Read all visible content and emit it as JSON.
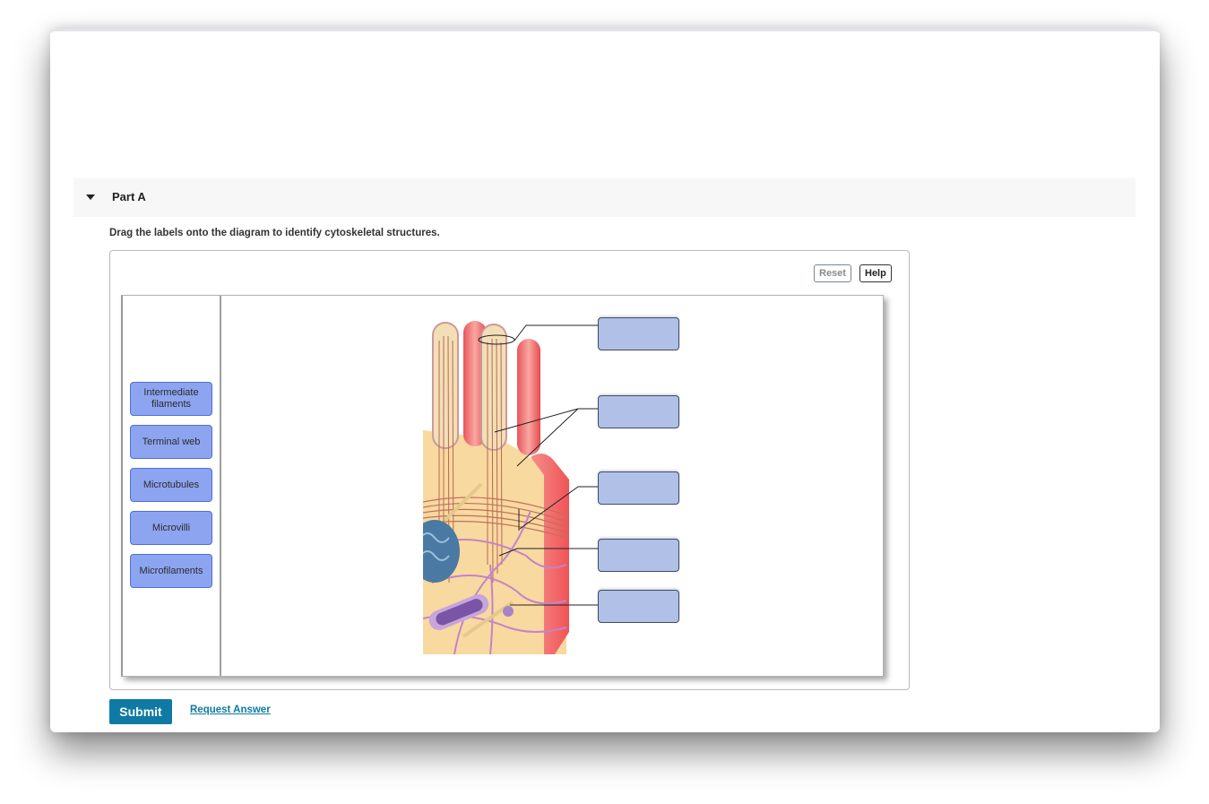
{
  "part": {
    "title": "Part A",
    "expanded": true
  },
  "instructions": "Drag the labels onto the diagram to identify cytoskeletal structures.",
  "toolbar": {
    "reset_label": "Reset",
    "help_label": "Help"
  },
  "labels": [
    {
      "text": "Intermediate filaments"
    },
    {
      "text": "Terminal web"
    },
    {
      "text": "Microtubules"
    },
    {
      "text": "Microvilli"
    },
    {
      "text": "Microfilaments"
    }
  ],
  "drop_targets": [
    {
      "value": ""
    },
    {
      "value": ""
    },
    {
      "value": ""
    },
    {
      "value": ""
    },
    {
      "value": ""
    }
  ],
  "actions": {
    "submit_label": "Submit",
    "request_answer_label": "Request Answer"
  },
  "colors": {
    "label_fill": "#8da4f0",
    "target_fill": "#b0c0e6",
    "submit_bg": "#0f7aa3",
    "link": "#0f7aa3"
  }
}
